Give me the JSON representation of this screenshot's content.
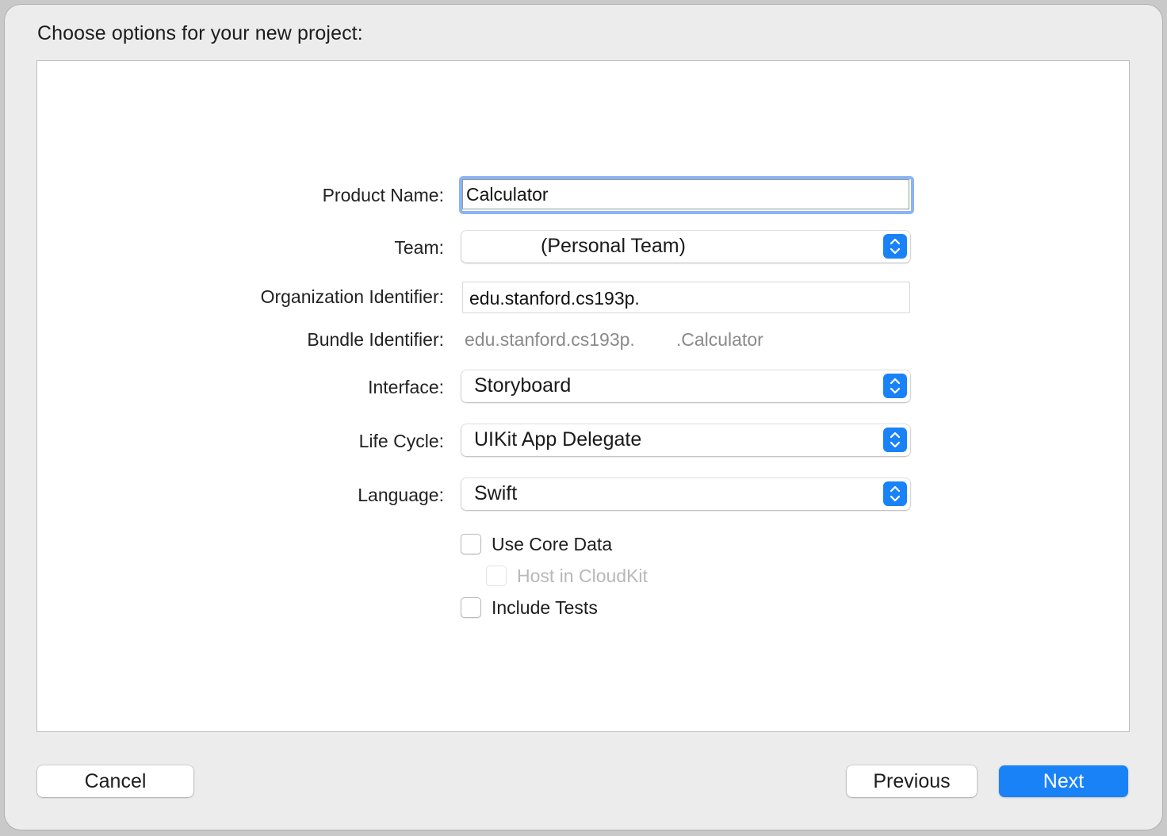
{
  "dialog": {
    "title": "Choose options for your new project:"
  },
  "form": {
    "product_name": {
      "label": "Product Name:",
      "value": "Calculator"
    },
    "team": {
      "label": "Team:",
      "value": "(Personal Team)"
    },
    "organization_identifier": {
      "label": "Organization Identifier:",
      "value": "edu.stanford.cs193p."
    },
    "bundle_identifier": {
      "label": "Bundle Identifier:",
      "prefix": "edu.stanford.cs193p.",
      "suffix": ".Calculator"
    },
    "interface": {
      "label": "Interface:",
      "value": "Storyboard"
    },
    "life_cycle": {
      "label": "Life Cycle:",
      "value": "UIKit App Delegate"
    },
    "language": {
      "label": "Language:",
      "value": "Swift"
    },
    "checkboxes": [
      {
        "label": "Use Core Data",
        "checked": false,
        "enabled": true
      },
      {
        "label": "Host in CloudKit",
        "checked": false,
        "enabled": false
      },
      {
        "label": "Include Tests",
        "checked": false,
        "enabled": true
      }
    ]
  },
  "buttons": {
    "cancel": "Cancel",
    "previous": "Previous",
    "next": "Next"
  },
  "colors": {
    "accent": "#1a82f7",
    "focus_ring": "#8ab4f5",
    "window_bg": "#ececec"
  },
  "icons": {
    "popup_stepper": "up-down-chevron-icon"
  }
}
